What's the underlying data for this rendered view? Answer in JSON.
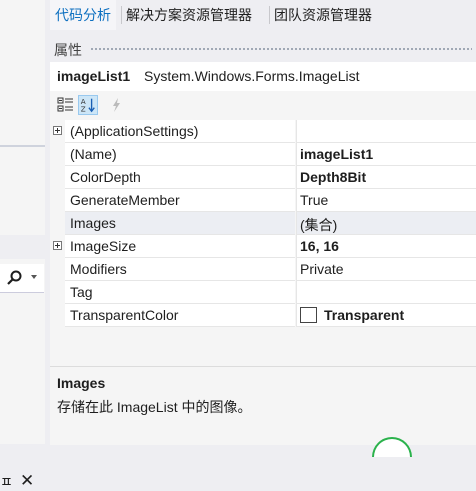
{
  "tabs": [
    {
      "label": "代码分析",
      "active": true
    },
    {
      "label": "解决方案资源管理器",
      "active": false
    },
    {
      "label": "团队资源管理器",
      "active": false
    }
  ],
  "panel_title": "属性",
  "object": {
    "name": "imageList1",
    "type": "System.Windows.Forms.ImageList"
  },
  "toolbar": {
    "categorized_icon": "categorized-icon",
    "alphabetical_icon": "alphabetical-icon",
    "events_icon": "lightning-icon"
  },
  "properties": [
    {
      "name": "(ApplicationSettings)",
      "value": "",
      "expandable": true,
      "bold": false
    },
    {
      "name": "(Name)",
      "value": "imageList1",
      "expandable": false,
      "bold": true
    },
    {
      "name": "ColorDepth",
      "value": "Depth8Bit",
      "expandable": false,
      "bold": true
    },
    {
      "name": "GenerateMember",
      "value": "True",
      "expandable": false,
      "bold": false
    },
    {
      "name": "Images",
      "value": "(集合)",
      "expandable": false,
      "bold": false,
      "selected": true
    },
    {
      "name": "ImageSize",
      "value": "16, 16",
      "expandable": true,
      "bold": true
    },
    {
      "name": "Modifiers",
      "value": "Private",
      "expandable": false,
      "bold": false
    },
    {
      "name": "Tag",
      "value": "",
      "expandable": false,
      "bold": false
    },
    {
      "name": "TransparentColor",
      "value": "Transparent",
      "expandable": false,
      "bold": true,
      "swatch": true
    }
  ],
  "description": {
    "title": "Images",
    "text": "存储在此 ImageList 中的图像。"
  },
  "colors": {
    "accent": "#0e70c0",
    "selected_row": "#eceef3",
    "panel_bg": "#f5f5f5"
  }
}
